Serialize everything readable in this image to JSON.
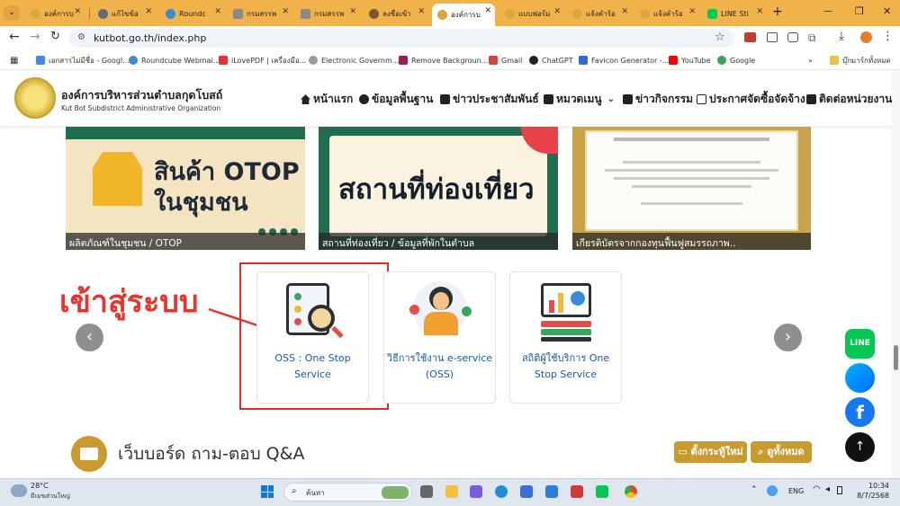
{
  "tabs": [
    {
      "label": "องค์การบ"
    },
    {
      "label": "แก้ไขข้อ"
    },
    {
      "label": "Roundc"
    },
    {
      "label": "กรมสรรพ"
    },
    {
      "label": "กรมสรรพ"
    },
    {
      "label": "ลงชื่อเข้า"
    },
    {
      "label": "องค์การบ"
    },
    {
      "label": "แบบฟอร์ม"
    },
    {
      "label": "แจ้งคำร้อ"
    },
    {
      "label": "แจ้งคำร้อ"
    },
    {
      "label": "LINE Sti"
    }
  ],
  "url": "kutbot.go.th/index.php",
  "bookmarks": [
    "เอกสารไม่มีชื่อ - Googl...",
    "Roundcube Webmai...",
    "iLovePDF | เครื่องมือ...",
    "Electronic Governm...",
    "Remove Backgroun...",
    "Gmail",
    "ChatGPT",
    "Favicon Generator -...",
    "YouTube",
    "Google",
    "บุ๊กมาร์กทั้งหมด"
  ],
  "site": {
    "name_th": "องค์การบริหารส่วนตำบลกุดโบสถ์",
    "name_en": "Kut Bot Subdistrict Administrative Organization"
  },
  "nav": [
    "หน้าแรก",
    "ข้อมูลพื้นฐาน",
    "ข่าวประชาสัมพันธ์",
    "หมวดเมนู",
    "ข่าวกิจกรรม",
    "ประกาศจัดซื้อจัดจ้าง",
    "ติดต่อหน่วยงาน"
  ],
  "banners": [
    {
      "title1": "สินค้า OTOP",
      "title2": "ในชุมชน",
      "caption": "ผลิตภัณฑ์ในชุมชน / OTOP"
    },
    {
      "title1": "สถานที่ท่องเที่ยว",
      "caption": "สถานที่ท่องเที่ยว / ข้อมูลที่พักในตำบล"
    },
    {
      "caption": "เกียรติบัตรจากกองทุนฟื้นฟูสมรรถภาพ.."
    }
  ],
  "annotation": "เข้าสู่ระบบ",
  "cards": [
    {
      "label": "OSS : One Stop Service"
    },
    {
      "label": "วิธีการใช้งาน e-service (OSS)"
    },
    {
      "label": "สถิติผู้ใช้บริการ One Stop Service"
    }
  ],
  "section": {
    "title": "เว็บบอร์ด ถาม-ตอบ Q&A",
    "new_topic": "ตั้งกระทู้ใหม่",
    "view_all": "ดูทั้งหมด"
  },
  "social": [
    "LINE"
  ],
  "taskbar": {
    "temp": "28°C",
    "weather": "มีเมฆส่วนใหญ่",
    "search": "ค้นหา",
    "lang": "ENG",
    "time": "10:34",
    "date": "8/7/2568"
  }
}
